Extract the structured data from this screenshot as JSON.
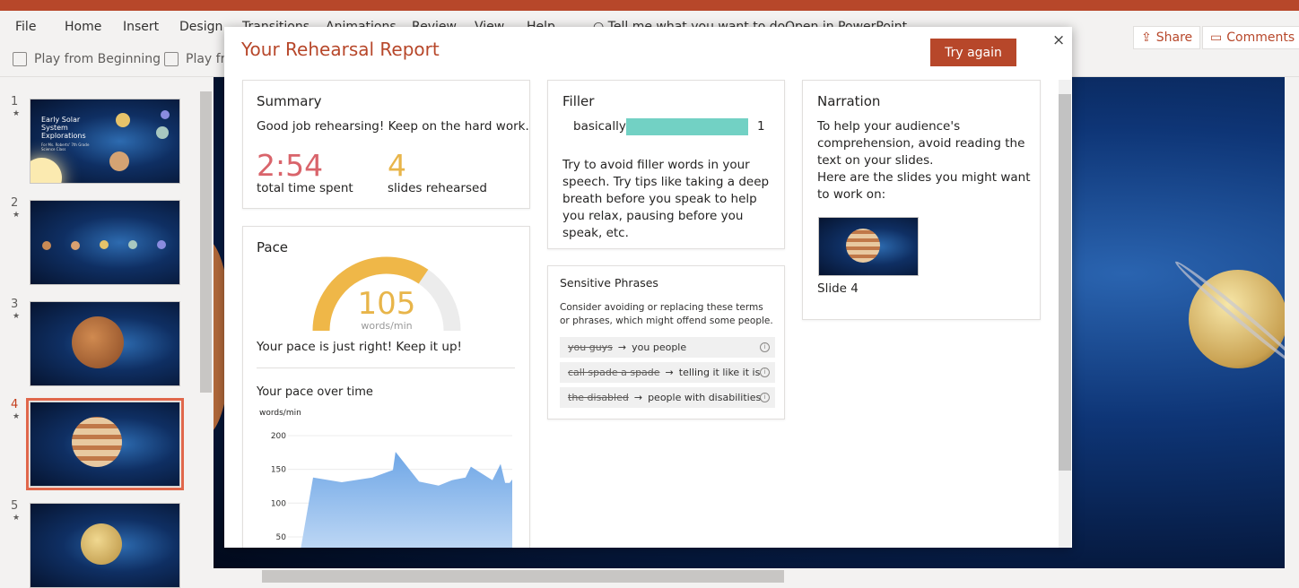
{
  "ribbon": {
    "tabs": [
      "File",
      "Home",
      "Insert",
      "Design",
      "Transitions",
      "Animations",
      "Review",
      "View",
      "Help"
    ],
    "tell_me": "Tell me what you want to do",
    "open_in": "Open in PowerPoint",
    "share": "Share",
    "comments": "Comments",
    "play_from_beginning": "Play from Beginning",
    "play_from_current": "Play from Current Slide"
  },
  "thumbnails": [
    {
      "number": "1",
      "title": "Early Solar System Explorations",
      "subtitle": "For Ms. Roberts' 7th Grade Science Class"
    },
    {
      "number": "2"
    },
    {
      "number": "3"
    },
    {
      "number": "4",
      "selected": true
    },
    {
      "number": "5"
    }
  ],
  "dialog": {
    "title": "Your Rehearsal Report",
    "try_again": "Try again",
    "close": "×",
    "summary": {
      "heading": "Summary",
      "message": "Good job rehearsing! Keep on the hard work.",
      "time_value": "2:54",
      "time_label": "total time spent",
      "slides_value": "4",
      "slides_label": "slides rehearsed"
    },
    "pace": {
      "heading": "Pace",
      "value": "105",
      "unit": "words/min",
      "gauge_fraction": 0.69,
      "message": "Your pace is just right! Keep it up!",
      "over_time_heading": "Your pace over time"
    },
    "filler": {
      "heading": "Filler",
      "words": [
        {
          "word": "basically",
          "count": "1",
          "fraction": 1.0
        }
      ],
      "tip": "Try to avoid filler words in your speech. Try tips like taking a deep breath before you speak to help you relax, pausing before you speak, etc."
    },
    "sensitive": {
      "heading": "Sensitive Phrases",
      "description": "Consider avoiding or replacing these terms or phrases, which might offend some people.",
      "phrases": [
        {
          "avoid": "you guys",
          "suggest": "you people"
        },
        {
          "avoid": "call spade a spade",
          "suggest": "telling it like it is"
        },
        {
          "avoid": "the disabled",
          "suggest": "people with disabilities"
        }
      ]
    },
    "narration": {
      "heading": "Narration",
      "text1": "To help your audience's comprehension, avoid reading the text on your slides.",
      "text2": "Here are the slides you might want to work on:",
      "slide_label": "Slide 4"
    }
  },
  "colors": {
    "accent": "#b7472a",
    "time": "#d9646b",
    "slides": "#e8b54a",
    "gauge": "#efb748",
    "filler": "#72d1c4",
    "area": "#6ea6e6"
  },
  "chart_data": {
    "type": "area",
    "title": "Your pace over time",
    "ylabel": "words/min",
    "yticks": [
      50,
      100,
      150,
      200
    ],
    "ylim": [
      0,
      200
    ],
    "xlim": [
      0,
      100
    ],
    "x": [
      0,
      7.5,
      20.8,
      35,
      44.6,
      45.8,
      56.7,
      65.8,
      72,
      78.3,
      80.8,
      90.8,
      94.6,
      96.7,
      98.8,
      100
    ],
    "y": [
      0,
      138,
      131,
      138,
      149,
      176,
      132,
      126,
      134,
      138,
      154,
      134,
      158,
      130,
      130,
      135
    ],
    "grid": true
  }
}
